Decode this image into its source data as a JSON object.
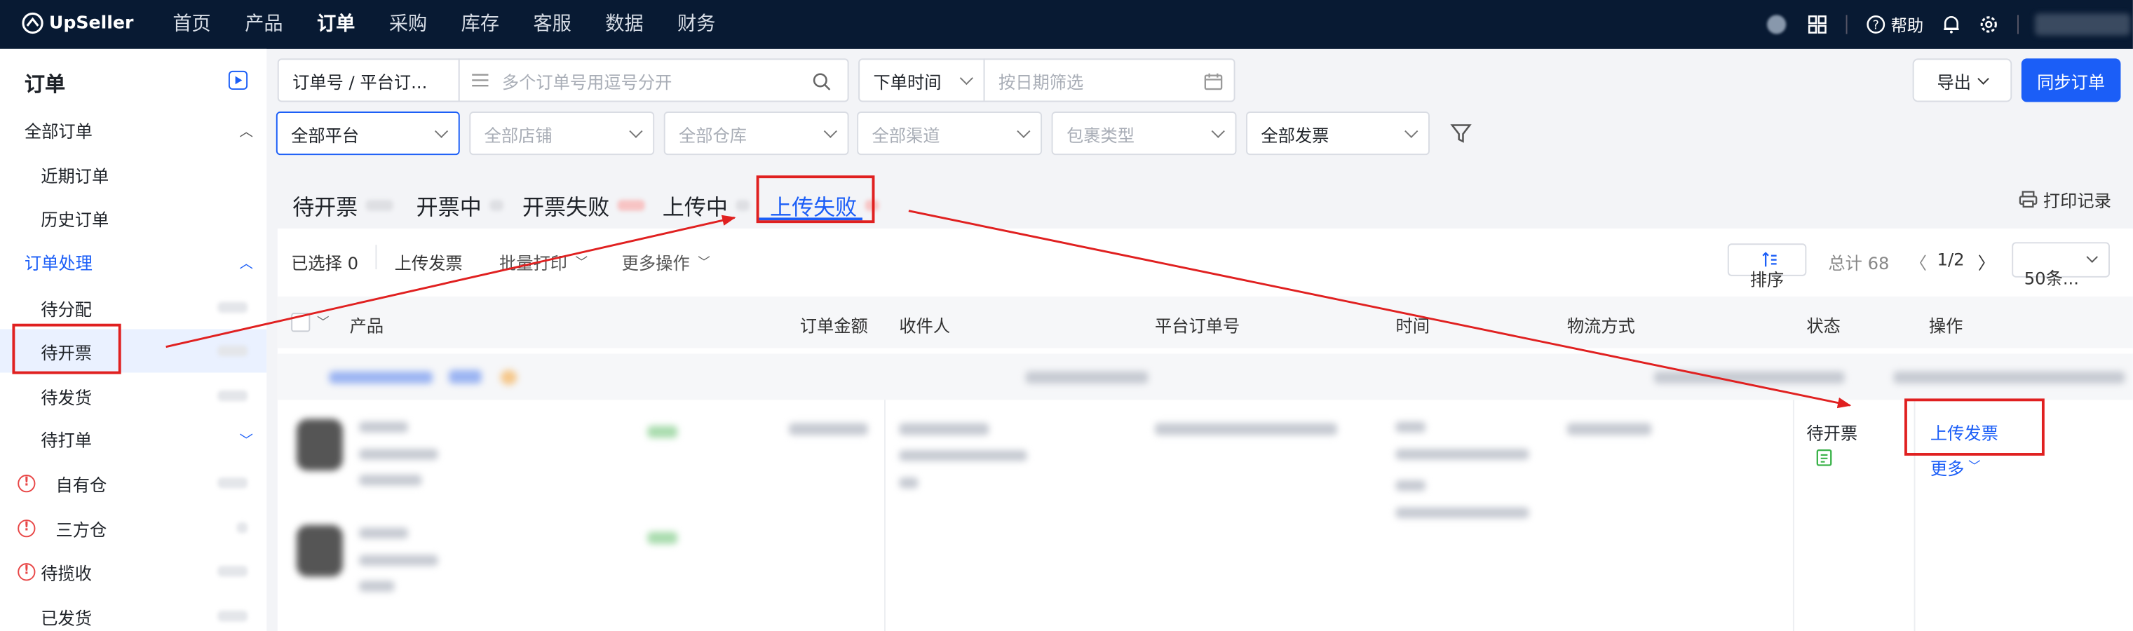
{
  "brand": "UpSeller",
  "nav": [
    "首页",
    "产品",
    "订单",
    "采购",
    "库存",
    "客服",
    "数据",
    "财务"
  ],
  "nav_active": 2,
  "help": "帮助",
  "sidebar": {
    "title": "订单",
    "groups": [
      {
        "label": "全部订单"
      },
      {
        "label": "近期订单"
      },
      {
        "label": "历史订单"
      },
      {
        "label": "订单处理"
      },
      {
        "label": "待分配"
      },
      {
        "label": "待开票"
      },
      {
        "label": "待发货"
      },
      {
        "label": "待打单"
      },
      {
        "label": "自有仓"
      },
      {
        "label": "三方仓"
      },
      {
        "label": "待揽收"
      },
      {
        "label": "已发货"
      }
    ]
  },
  "filters": {
    "search_type": "订单号 / 平台订...",
    "search_placeholder": "多个订单号用逗号分开",
    "time_type": "下单时间",
    "date_placeholder": "按日期筛选",
    "platform": "全部平台",
    "shop": "全部店铺",
    "warehouse": "全部仓库",
    "channel": "全部渠道",
    "package": "包裹类型",
    "invoice": "全部发票",
    "export": "导出",
    "sync": "同步订单"
  },
  "tabs": [
    "待开票",
    "开票中",
    "开票失败",
    "上传中",
    "上传失败"
  ],
  "print_record": "打印记录",
  "toolbar": {
    "selected": "已选择 0",
    "upload_invoice": "上传发票",
    "batch_print": "批量打印",
    "more_ops": "更多操作",
    "sort": "排序",
    "total": "总计 68",
    "page": "1/2",
    "page_size": "50条..."
  },
  "columns": [
    "产品",
    "订单金额",
    "收件人",
    "平台订单号",
    "时间",
    "物流方式",
    "状态",
    "操作"
  ],
  "row": {
    "status": "待开票",
    "action_upload": "上传发票",
    "action_more": "更多"
  },
  "colors": {
    "accent": "#1b5ef7",
    "nav_bg": "#081a33",
    "annotation": "#e02020"
  }
}
